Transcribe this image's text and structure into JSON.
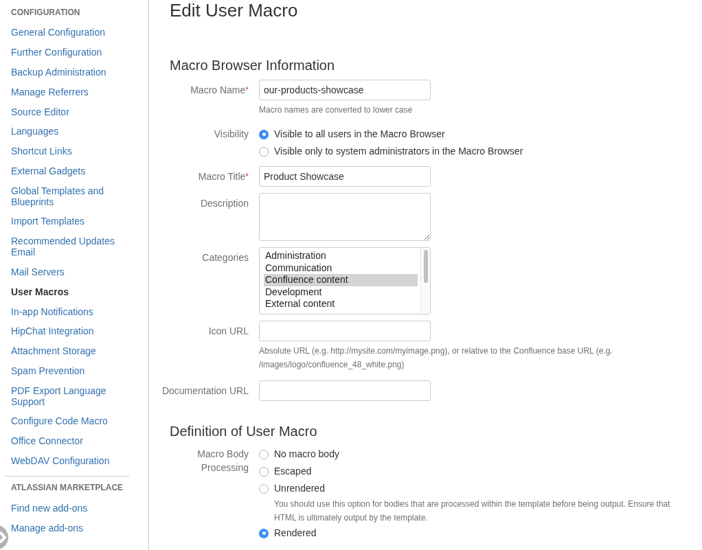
{
  "sidebar": {
    "sections": [
      {
        "heading": "CONFIGURATION",
        "items": [
          {
            "label": "General Configuration",
            "selected": false
          },
          {
            "label": "Further Configuration",
            "selected": false
          },
          {
            "label": "Backup Administration",
            "selected": false
          },
          {
            "label": "Manage Referrers",
            "selected": false
          },
          {
            "label": "Source Editor",
            "selected": false
          },
          {
            "label": "Languages",
            "selected": false
          },
          {
            "label": "Shortcut Links",
            "selected": false
          },
          {
            "label": "External Gadgets",
            "selected": false
          },
          {
            "label": "Global Templates and Blueprints",
            "selected": false
          },
          {
            "label": "Import Templates",
            "selected": false
          },
          {
            "label": "Recommended Updates Email",
            "selected": false
          },
          {
            "label": "Mail Servers",
            "selected": false
          },
          {
            "label": "User Macros",
            "selected": true
          },
          {
            "label": "In-app Notifications",
            "selected": false
          },
          {
            "label": "HipChat Integration",
            "selected": false
          },
          {
            "label": "Attachment Storage",
            "selected": false
          },
          {
            "label": "Spam Prevention",
            "selected": false
          },
          {
            "label": "PDF Export Language Support",
            "selected": false
          },
          {
            "label": "Configure Code Macro",
            "selected": false
          },
          {
            "label": "Office Connector",
            "selected": false
          },
          {
            "label": "WebDAV Configuration",
            "selected": false
          }
        ]
      },
      {
        "heading": "ATLASSIAN MARKETPLACE",
        "items": [
          {
            "label": "Find new add-ons",
            "selected": false
          },
          {
            "label": "Manage add-ons",
            "selected": false
          }
        ]
      }
    ]
  },
  "page": {
    "title": "Edit User Macro",
    "sections": [
      {
        "heading": "Macro Browser Information",
        "rows": [
          {
            "kind": "text",
            "label": "Macro Name",
            "required_mark": "*",
            "value": "our-products-showcase",
            "hint": "Macro names are converted to lower case"
          },
          {
            "kind": "radio",
            "label": "Visibility",
            "options": [
              {
                "label": "Visible to all users in the Macro Browser",
                "selected": true
              },
              {
                "label": "Visible only to system administrators in the Macro Browser",
                "selected": false
              }
            ]
          },
          {
            "kind": "text",
            "label": "Macro Title",
            "required_mark": "*",
            "value": "Product Showcase"
          },
          {
            "kind": "textarea",
            "label": "Description"
          },
          {
            "kind": "listbox",
            "label": "Categories",
            "options": [
              {
                "label": "Administration",
                "selected": false
              },
              {
                "label": "Communication",
                "selected": false
              },
              {
                "label": "Confluence content",
                "selected": true
              },
              {
                "label": "Development",
                "selected": false
              },
              {
                "label": "External content",
                "selected": false
              }
            ]
          },
          {
            "kind": "text",
            "label": "Icon URL",
            "hint": "Absolute URL (e.g. http://mysite.com/myimage.png), or relative to the Confluence base URL (e.g. /images/logo/confluence_48_white.png)"
          },
          {
            "kind": "text",
            "label": "Documentation URL"
          }
        ]
      },
      {
        "heading": "Definition of User Macro",
        "rows": [
          {
            "kind": "radio",
            "label": "Macro Body Processing",
            "options": [
              {
                "label": "No macro body",
                "selected": false
              },
              {
                "label": "Escaped",
                "selected": false
              },
              {
                "label": "Unrendered",
                "selected": false,
                "note": "You should use this option for bodies that are processed within the template before being output. Ensure that HTML is ultimately output by the template."
              },
              {
                "label": "Rendered",
                "selected": true
              }
            ]
          }
        ]
      }
    ]
  }
}
